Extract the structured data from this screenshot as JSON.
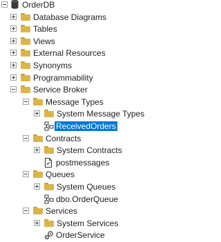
{
  "tree": {
    "database": "OrderDB",
    "items": {
      "database_diagrams": "Database Diagrams",
      "tables": "Tables",
      "views": "Views",
      "external_resources": "External Resources",
      "synonyms": "Synonyms",
      "programmability": "Programmability",
      "service_broker": "Service Broker",
      "message_types": "Message Types",
      "system_message_types": "System Message Types",
      "received_orders": "ReceivedOrders",
      "contracts": "Contracts",
      "system_contracts": "System Contracts",
      "postmessages": "postmessages",
      "queues": "Queues",
      "system_queues": "System Queues",
      "order_queue": "dbo.OrderQueue",
      "services": "Services",
      "system_services": "System Services",
      "order_service": "OrderService"
    }
  },
  "colors": {
    "selection": "#0078d7",
    "folder": "#dcb44a"
  }
}
